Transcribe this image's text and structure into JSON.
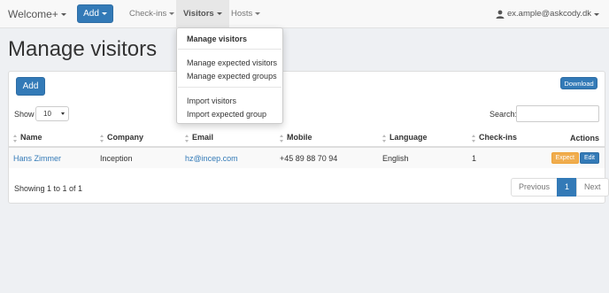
{
  "navbar": {
    "brand": "Welcome+",
    "add_label": "Add",
    "checkins_label": "Check-ins",
    "visitors_label": "Visitors",
    "hosts_label": "Hosts",
    "user_email": "ex.ample@askcody.dk"
  },
  "page": {
    "title": "Manage visitors"
  },
  "toolbar": {
    "add_label": "Add",
    "download_label": "Download",
    "show_label": "Show",
    "show_value": "10",
    "search_label": "Search:"
  },
  "table": {
    "columns": [
      "Name",
      "Company",
      "Email",
      "Mobile",
      "Language",
      "Check-ins",
      "Actions"
    ],
    "rows": [
      {
        "name": "Hans Zimmer",
        "company": "Inception",
        "email": "hz@incep.com",
        "mobile": "+45 89 88 70 94",
        "language": "English",
        "checkins": "1",
        "expect_label": "Expect",
        "edit_label": "Edit"
      }
    ]
  },
  "footer": {
    "showing": "Showing 1 to 1 of 1",
    "previous": "Previous",
    "page": "1",
    "next": "Next"
  },
  "dropdown": {
    "items": [
      "Manage visitors",
      "Manage expected visitors",
      "Manage expected groups",
      "Import visitors",
      "Import expected group"
    ]
  },
  "colors": {
    "primary": "#337ab7",
    "warning": "#f0ad4e",
    "navbar_bg": "#f8f8f8",
    "page_bg": "#eef0f3"
  }
}
